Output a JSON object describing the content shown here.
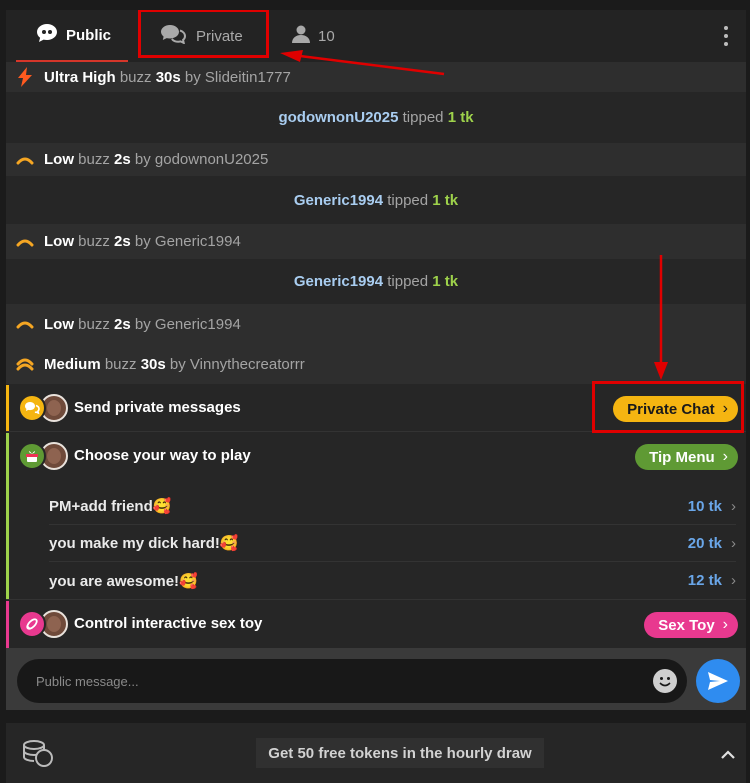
{
  "tabs": {
    "public_label": "Public",
    "private_label": "Private",
    "users_count": "10"
  },
  "feed": [
    {
      "kind": "buzz",
      "level": "Ultra High",
      "word": "buzz",
      "duration": "30s",
      "by": "by",
      "user": "Slideitin1777",
      "icon": "lightning-icon"
    },
    {
      "kind": "tip",
      "user": "godownonU2025",
      "verb": "tipped",
      "amount": "1 tk"
    },
    {
      "kind": "buzz",
      "level": "Low",
      "word": "buzz",
      "duration": "2s",
      "by": "by",
      "user": "godownonU2025",
      "icon": "low-vibration-icon"
    },
    {
      "kind": "tip",
      "user": "Generic1994",
      "verb": "tipped",
      "amount": "1 tk"
    },
    {
      "kind": "buzz",
      "level": "Low",
      "word": "buzz",
      "duration": "2s",
      "by": "by",
      "user": "Generic1994",
      "icon": "low-vibration-icon"
    },
    {
      "kind": "tip",
      "user": "Generic1994",
      "verb": "tipped",
      "amount": "1 tk"
    },
    {
      "kind": "buzz",
      "level": "Low",
      "word": "buzz",
      "duration": "2s",
      "by": "by",
      "user": "Generic1994",
      "icon": "low-vibration-icon"
    },
    {
      "kind": "buzz",
      "level": "Medium",
      "word": "buzz",
      "duration": "30s",
      "by": "by",
      "user": "Vinnythecreatorrr",
      "icon": "medium-vibration-icon"
    }
  ],
  "promos": {
    "private_chat": {
      "title": "Send private messages",
      "button": "Private Chat",
      "color": "#f5b511"
    },
    "tip_menu": {
      "title": "Choose your way to play",
      "button": "Tip Menu",
      "color": "#5f9a34",
      "items": [
        {
          "label": "PM+add friend🥰",
          "price": "10 tk"
        },
        {
          "label": "you make my dick hard!🥰",
          "price": "20 tk"
        },
        {
          "label": "you are awesome!🥰",
          "price": "12 tk"
        }
      ]
    },
    "sex_toy": {
      "title": "Control interactive sex toy",
      "button": "Sex Toy",
      "color": "#e8398f"
    }
  },
  "input": {
    "placeholder": "Public message..."
  },
  "bottom": {
    "banner": "Get 50 free tokens in the hourly draw"
  },
  "colors": {
    "accent_red": "#d6362a",
    "annotation": "#e00000",
    "send": "#2f8cf0",
    "tip_amount": "#9ed24b",
    "tip_user": "#a9cdf0",
    "price": "#6aa6e8"
  }
}
